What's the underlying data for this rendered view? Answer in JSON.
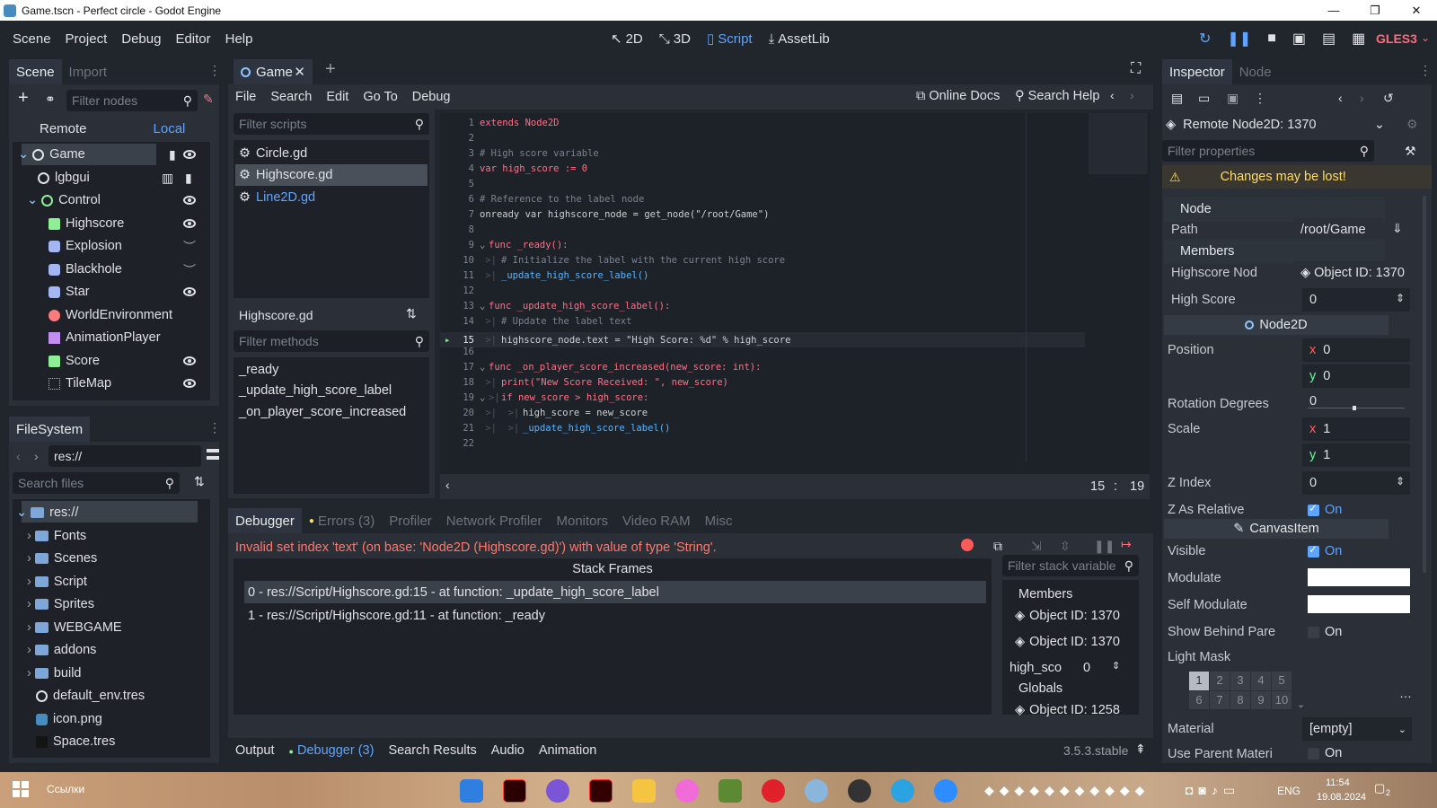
{
  "window": {
    "title": "Game.tscn - Perfect circle - Godot Engine"
  },
  "menubar": {
    "items": [
      "Scene",
      "Project",
      "Debug",
      "Editor",
      "Help"
    ],
    "workspaces": [
      "2D",
      "3D",
      "Script",
      "AssetLib"
    ],
    "renderer": "GLES3"
  },
  "scene_dock": {
    "tabs": [
      "Scene",
      "Import"
    ],
    "filter_placeholder": "Filter nodes",
    "remote": "Remote",
    "local": "Local",
    "nodes": [
      "Game",
      "lgbgui",
      "Control",
      "Highscore",
      "Explosion",
      "Blackhole",
      "Star",
      "WorldEnvironment",
      "AnimationPlayer",
      "Score",
      "TileMap"
    ]
  },
  "filesystem": {
    "title": "FileSystem",
    "path": "res://",
    "search_placeholder": "Search files",
    "items": [
      "res://",
      "Fonts",
      "Scenes",
      "Script",
      "Sprites",
      "WEBGAME",
      "addons",
      "build",
      "default_env.tres",
      "icon.png",
      "Space.tres"
    ]
  },
  "editor_tabs": {
    "scene_tab": "Game"
  },
  "script_menu": {
    "items": [
      "File",
      "Search",
      "Edit",
      "Go To",
      "Debug"
    ],
    "online_docs": "Online Docs",
    "search_help": "Search Help"
  },
  "script_list": {
    "filter_placeholder": "Filter scripts",
    "scripts": [
      "Circle.gd",
      "Highscore.gd",
      "Line2D.gd"
    ],
    "current": "Highscore.gd",
    "methods_placeholder": "Filter methods",
    "methods": [
      "_ready",
      "_update_high_score_label",
      "_on_player_score_increased"
    ]
  },
  "code": {
    "lines": [
      "extends Node2D",
      "",
      "# High score variable",
      "var high_score := 0",
      "",
      "# Reference to the label node",
      "onready var highscore_node = get_node(\"/root/Game\")",
      "",
      "func _ready():",
      "# Initialize the label with the current high score",
      "_update_high_score_label()",
      "",
      "func _update_high_score_label():",
      "# Update the label text",
      "highscore_node.text = \"High Score: %d\" % high_score",
      "",
      "func _on_player_score_increased(new_score: int):",
      "print(\"New Score Received: \", new_score)",
      "if new_score > high_score:",
      "high_score = new_score",
      "_update_high_score_label()",
      ""
    ],
    "cursor_line": "15",
    "cursor_sep": ":",
    "cursor_col": "19"
  },
  "debugger": {
    "tabs": [
      "Debugger",
      "Errors (3)",
      "Profiler",
      "Network Profiler",
      "Monitors",
      "Video RAM",
      "Misc"
    ],
    "error": "Invalid set index 'text' (on base: 'Node2D (Highscore.gd)') with value of type 'String'.",
    "stack_title": "Stack Frames",
    "frames": [
      "0 - res://Script/Highscore.gd:15 - at function: _update_high_score_label",
      "1 - res://Script/Highscore.gd:11 - at function: _ready"
    ],
    "vars_placeholder": "Filter stack variable",
    "members_label": "Members",
    "obj1": "Object ID: 1370",
    "obj2": "Object ID: 1370",
    "var_name": "high_sco",
    "var_value": "0",
    "globals_label": "Globals",
    "obj3": "Object ID: 1258"
  },
  "bottom_bar": {
    "tabs": [
      "Output",
      "Debugger (3)",
      "Search Results",
      "Audio",
      "Animation"
    ],
    "version": "3.5.3.stable"
  },
  "inspector": {
    "tabs": [
      "Inspector",
      "Node"
    ],
    "object": "Remote Node2D: 1370",
    "filter_placeholder": "Filter properties",
    "warning": "Changes may be lost!",
    "node_label": "Node",
    "path_label": "Path",
    "path_value": "/root/Game",
    "members_label": "Members",
    "highscore_node_label": "Highscore Nod",
    "highscore_node_value": "Object ID: 1370",
    "high_score_label": "High Score",
    "high_score_value": "0",
    "node2d_section": "Node2D",
    "position_label": "Position",
    "pos_x_axis": "x",
    "pos_x": "0",
    "pos_y_axis": "y",
    "pos_y": "0",
    "rotation_label": "Rotation Degrees",
    "rotation_value": "0",
    "scale_label": "Scale",
    "scale_x_axis": "x",
    "scale_x": "1",
    "scale_y_axis": "y",
    "scale_y": "1",
    "zindex_label": "Z Index",
    "zindex_value": "0",
    "zrel_label": "Z As Relative",
    "on": "On",
    "canvasitem_section": "CanvasItem",
    "visible_label": "Visible",
    "modulate_label": "Modulate",
    "self_modulate_label": "Self Modulate",
    "show_behind_label": "Show Behind Pare",
    "light_mask_label": "Light Mask",
    "light_mask": [
      "1",
      "2",
      "3",
      "4",
      "5",
      "6",
      "7",
      "8",
      "9",
      "10"
    ],
    "material_label": "Material",
    "material_value": "[empty]",
    "use_parent_label": "Use Parent Materi"
  },
  "taskbar": {
    "search_text": "Ссылки",
    "lang": "ENG",
    "time": "11:54",
    "date": "19.08.2024",
    "notifications": "2"
  },
  "colors": {
    "accent": "#5fa4ff",
    "error": "#ff786b",
    "warning": "#ffdd65",
    "background": "#21252c"
  }
}
